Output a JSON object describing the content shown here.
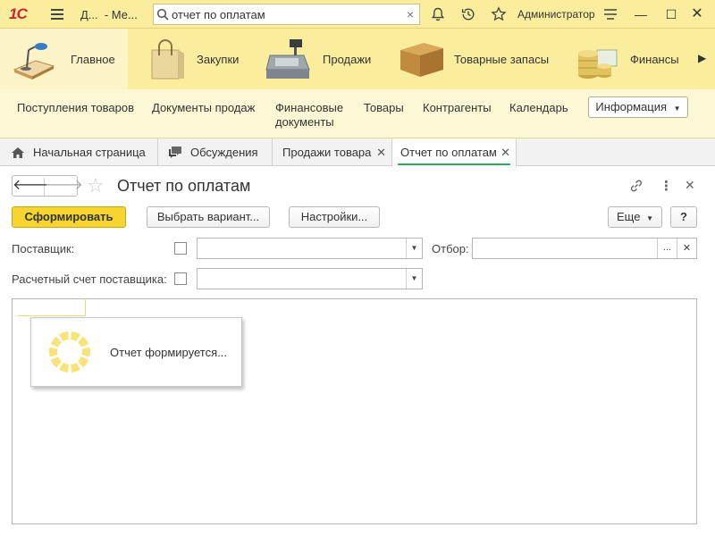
{
  "app": {
    "logo_text": "1С",
    "window_title": "Д...  - Ме...",
    "search_value": "отчет по оплатам",
    "user": "Администратор"
  },
  "sections": [
    {
      "label": "Главное",
      "icon": "desk-lamp-icon",
      "active": true
    },
    {
      "label": "Закупки",
      "icon": "shopping-bag-icon"
    },
    {
      "label": "Продажи",
      "icon": "cash-register-icon"
    },
    {
      "label": "Товарные запасы",
      "icon": "cardboard-box-icon"
    },
    {
      "label": "Финансы",
      "icon": "coins-icon"
    }
  ],
  "functions": {
    "items": [
      "Поступления товаров",
      "Документы продаж",
      "Финансовые\nдокументы",
      "Товары",
      "Контрагенты",
      "Календарь"
    ],
    "info_button": "Информация"
  },
  "tabs": [
    {
      "label": "Начальная страница",
      "icon": "home-icon"
    },
    {
      "label": "Обсуждения",
      "icon": "chat-icon"
    },
    {
      "label": "Продажи товара",
      "closable": true
    },
    {
      "label": "Отчет по оплатам",
      "closable": true,
      "active": true
    }
  ],
  "form": {
    "title": "Отчет по оплатам",
    "buttons": {
      "generate": "Сформировать",
      "choose_variant": "Выбрать вариант...",
      "settings": "Настройки...",
      "more": "Еще",
      "help": "?"
    },
    "fields": {
      "supplier_label": "Поставщик:",
      "filter_label": "Отбор:",
      "filter_select": "...",
      "account_label": "Расчетный счет поставщика:"
    },
    "loading_text": "Отчет формируется..."
  },
  "colors": {
    "title_bar": "#fbed9e",
    "section_active": "#fcf3c7",
    "function_panel": "#fcf7d5",
    "primary_button": "#f6d531",
    "active_tab_underline": "#34a853",
    "spinner": "#f8e27a"
  }
}
